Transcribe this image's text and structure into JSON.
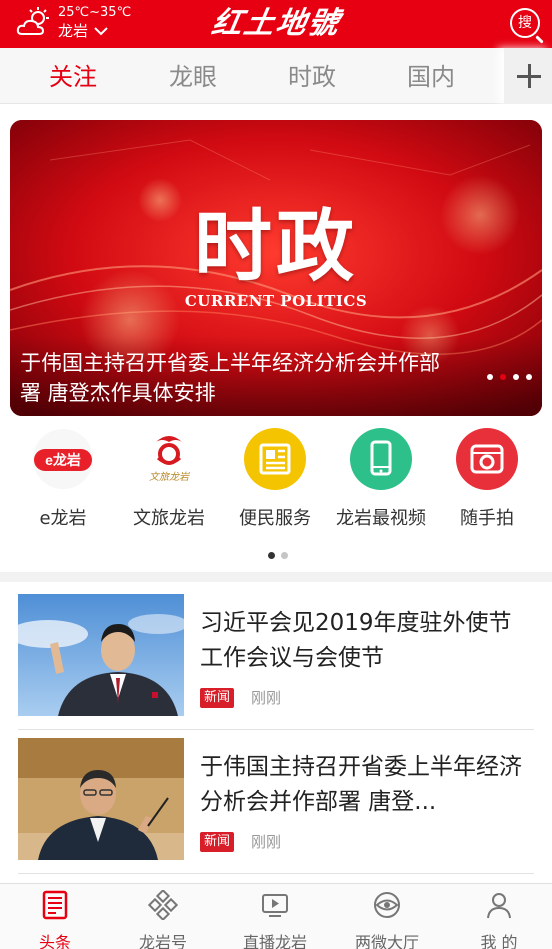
{
  "header": {
    "temperature": "25℃~35℃",
    "city": "龙岩",
    "logo_text": "红土地號",
    "search_label": "搜"
  },
  "tabs": [
    {
      "label": "关注",
      "active": true
    },
    {
      "label": "龙眼",
      "active": false
    },
    {
      "label": "时政",
      "active": false
    },
    {
      "label": "国内",
      "active": false
    }
  ],
  "banner": {
    "title": "时政",
    "subtitle": "CURRENT POLITICS",
    "caption": "于伟国主持召开省委上半年经济分析会并作部署 唐登杰作具体安排",
    "slide_count": 4,
    "active_slide": 2
  },
  "quick_entries": [
    {
      "label": "e龙岩",
      "icon": "e-longyan-logo-icon",
      "logo_text": "e龙岩"
    },
    {
      "label": "文旅龙岩",
      "icon": "wenlv-longyan-logo-icon",
      "logo_text": "文旅龙岩"
    },
    {
      "label": "便民服务",
      "icon": "newspaper-icon",
      "color": "#f5c400"
    },
    {
      "label": "龙岩最视频",
      "icon": "phone-icon",
      "color": "#2ec08a"
    },
    {
      "label": "随手拍",
      "icon": "camera-icon",
      "color": "#e8303a"
    }
  ],
  "quick_pages": 2,
  "news": [
    {
      "title": "习近平会见2019年度驻外使节工作会议与会使节",
      "tag": "新闻",
      "time": "刚刚"
    },
    {
      "title": "于伟国主持召开省委上半年经济分析会并作部署 唐登...",
      "tag": "新闻",
      "time": "刚刚"
    }
  ],
  "bottom_nav": [
    {
      "label": "头条",
      "icon": "headline-icon",
      "active": true
    },
    {
      "label": "龙岩号",
      "icon": "diamond-grid-icon",
      "active": false
    },
    {
      "label": "直播龙岩",
      "icon": "live-play-icon",
      "active": false
    },
    {
      "label": "两微大厅",
      "icon": "eye-icon",
      "active": false
    },
    {
      "label": "我 的",
      "icon": "user-icon",
      "active": false
    }
  ],
  "colors": {
    "brand_red": "#e60012",
    "tab_inactive": "#8a8a8a",
    "tag_red": "#d81e28"
  }
}
